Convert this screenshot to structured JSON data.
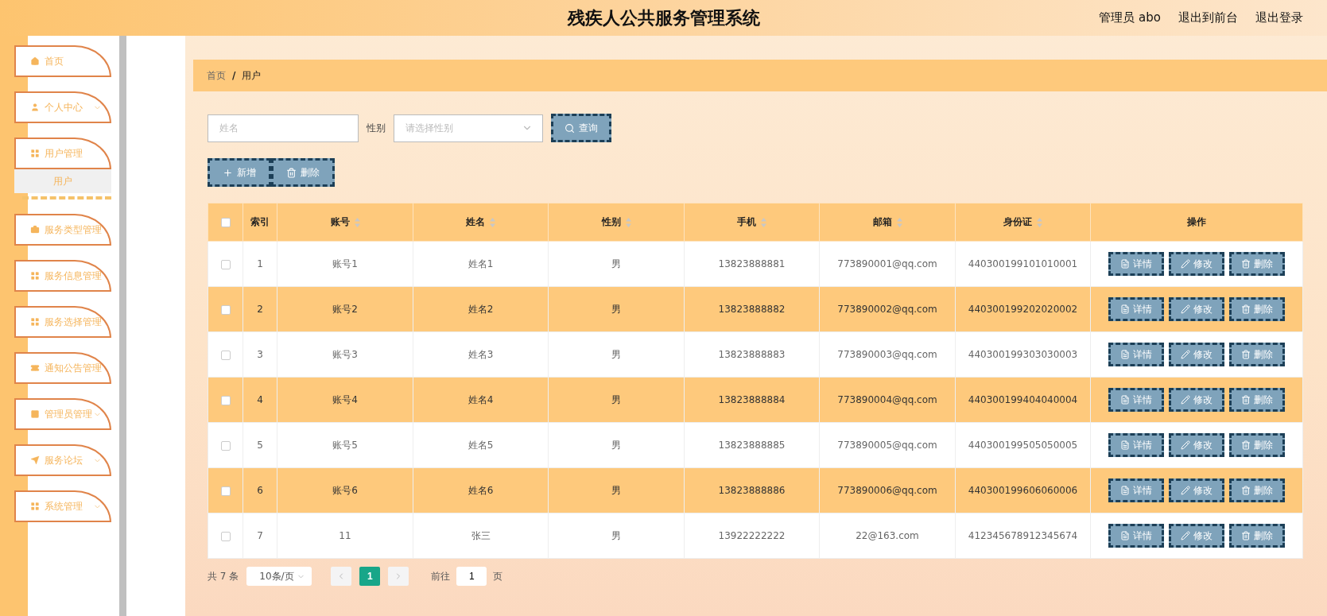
{
  "header": {
    "title": "残疾人公共服务管理系统",
    "links": [
      "管理员 abo",
      "退出到前台",
      "退出登录"
    ]
  },
  "sidebar": {
    "items": [
      {
        "label": "首页",
        "kind": "link"
      },
      {
        "label": "个人中心",
        "kind": "menu",
        "expanded": false
      },
      {
        "label": "用户管理",
        "kind": "menu",
        "expanded": true,
        "children": [
          {
            "label": "用户",
            "selected": true
          }
        ]
      },
      {
        "label": "服务类型管理",
        "kind": "menu",
        "expanded": false
      },
      {
        "label": "服务信息管理",
        "kind": "menu",
        "expanded": false
      },
      {
        "label": "服务选择管理",
        "kind": "menu",
        "expanded": false
      },
      {
        "label": "通知公告管理",
        "kind": "menu",
        "expanded": false
      },
      {
        "label": "管理员管理",
        "kind": "menu",
        "expanded": false
      },
      {
        "label": "服务论坛",
        "kind": "menu",
        "expanded": false
      },
      {
        "label": "系统管理",
        "kind": "menu",
        "expanded": false
      }
    ]
  },
  "breadcrumb": [
    "首页",
    "用户"
  ],
  "breadcrumb_separator": "/",
  "search": {
    "name_placeholder": "姓名",
    "gender_label": "性别",
    "gender_placeholder": "请选择性别",
    "query_button": "查询"
  },
  "actions": [
    {
      "label": "新增",
      "kind": "add"
    },
    {
      "label": "删除",
      "kind": "delete"
    }
  ],
  "table": {
    "select_all_checked": false,
    "columns": [
      {
        "label": "索引",
        "sortable": false
      },
      {
        "label": "账号",
        "sortable": true
      },
      {
        "label": "姓名",
        "sortable": true
      },
      {
        "label": "性别",
        "sortable": true
      },
      {
        "label": "手机",
        "sortable": true
      },
      {
        "label": "邮箱",
        "sortable": true
      },
      {
        "label": "身份证",
        "sortable": true
      },
      {
        "label": "操作",
        "sortable": false
      }
    ],
    "rows": [
      {
        "checked": false,
        "cells": [
          "1",
          "账号1",
          "姓名1",
          "男",
          "13823888881",
          "773890001@qq.com",
          "440300199101010001"
        ],
        "actions": [
          "详情",
          "修改",
          "删除"
        ]
      },
      {
        "checked": false,
        "cells": [
          "2",
          "账号2",
          "姓名2",
          "男",
          "13823888882",
          "773890002@qq.com",
          "440300199202020002"
        ],
        "actions": [
          "详情",
          "修改",
          "删除"
        ]
      },
      {
        "checked": false,
        "cells": [
          "3",
          "账号3",
          "姓名3",
          "男",
          "13823888883",
          "773890003@qq.com",
          "440300199303030003"
        ],
        "actions": [
          "详情",
          "修改",
          "删除"
        ]
      },
      {
        "checked": false,
        "cells": [
          "4",
          "账号4",
          "姓名4",
          "男",
          "13823888884",
          "773890004@qq.com",
          "440300199404040004"
        ],
        "actions": [
          "详情",
          "修改",
          "删除"
        ]
      },
      {
        "checked": false,
        "cells": [
          "5",
          "账号5",
          "姓名5",
          "男",
          "13823888885",
          "773890005@qq.com",
          "440300199505050005"
        ],
        "actions": [
          "详情",
          "修改",
          "删除"
        ]
      },
      {
        "checked": false,
        "cells": [
          "6",
          "账号6",
          "姓名6",
          "男",
          "13823888886",
          "773890006@qq.com",
          "440300199606060006"
        ],
        "actions": [
          "详情",
          "修改",
          "删除"
        ]
      },
      {
        "checked": false,
        "cells": [
          "7",
          "11",
          "张三",
          "男",
          "13922222222",
          "22@163.com",
          "412345678912345674"
        ],
        "actions": [
          "详情",
          "修改",
          "删除"
        ]
      }
    ]
  },
  "pagination": {
    "total": "共 7 条",
    "page_size": "10条/页",
    "pages": [
      {
        "label": "1",
        "selected": true
      }
    ],
    "goto_label": "前往",
    "goto_value": "1",
    "goto_suffix": "页"
  }
}
